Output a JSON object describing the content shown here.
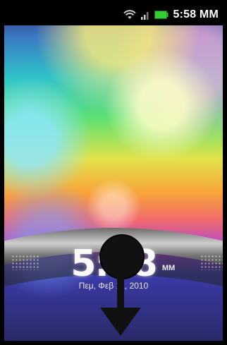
{
  "status_bar": {
    "time": "5:58 MM",
    "icons": [
      "wifi-icon",
      "signal-icon",
      "battery-icon"
    ]
  },
  "lock_screen": {
    "clock_time": "5:58",
    "clock_ampm": "MM",
    "date": "Πεμ, Φεβ 11, 2010",
    "gesture": "drag-down-arrow"
  },
  "colors": {
    "battery": "#33cc33",
    "arrow": "#111111"
  }
}
